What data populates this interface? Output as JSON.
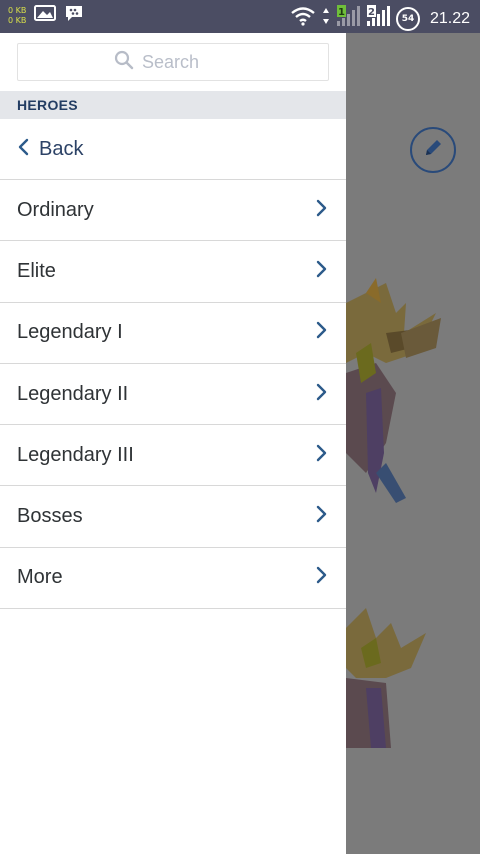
{
  "status_bar": {
    "kb_up": "0 KB",
    "kb_down": "0 KB",
    "sim1": "1",
    "sim2": "2",
    "battery": "54",
    "time": "21.22"
  },
  "search": {
    "placeholder": "Search"
  },
  "drawer": {
    "section_title": "HEROES",
    "back_label": "Back",
    "items": [
      {
        "label": "Ordinary"
      },
      {
        "label": "Elite"
      },
      {
        "label": "Legendary I"
      },
      {
        "label": "Legendary II"
      },
      {
        "label": "Legendary III"
      },
      {
        "label": "Bosses"
      },
      {
        "label": "More"
      }
    ]
  },
  "colors": {
    "status_bar": "#4b4d63",
    "accent": "#294a7a",
    "overlay": "#7b7b7b",
    "section_bg": "#e4e6ea"
  },
  "icons": [
    "search-icon",
    "back-chevron-icon",
    "chevron-right-icon",
    "edit-pencil-icon",
    "wifi-icon",
    "signal-icon",
    "image-icon",
    "bbm-icon"
  ]
}
